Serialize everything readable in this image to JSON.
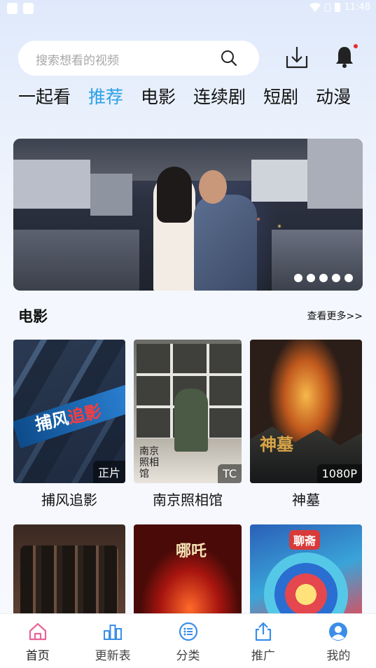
{
  "status_bar": {
    "time": "11:48"
  },
  "search": {
    "placeholder": "搜索想看的视频"
  },
  "tabs": [
    {
      "label": "一起看",
      "active": false
    },
    {
      "label": "推荐",
      "active": true
    },
    {
      "label": "电影",
      "active": false
    },
    {
      "label": "连续剧",
      "active": false
    },
    {
      "label": "短剧",
      "active": false
    },
    {
      "label": "动漫",
      "active": false
    }
  ],
  "banner": {
    "dot_count": 5
  },
  "section": {
    "title": "电影",
    "more_label": "查看更多>>"
  },
  "movies": [
    {
      "title": "捕风追影",
      "badge": "正片",
      "poster_text": "捕风追影"
    },
    {
      "title": "南京照相馆",
      "badge": "TC",
      "poster_text": "南京照相馆"
    },
    {
      "title": "神墓",
      "badge": "1080P",
      "poster_text": "神墓"
    },
    {
      "title": "",
      "badge": ""
    },
    {
      "title": "",
      "badge": "",
      "poster_text": "哪吒"
    },
    {
      "title": "",
      "badge": "",
      "poster_text": "聊斋"
    }
  ],
  "nav": [
    {
      "label": "首页",
      "icon": "home-icon",
      "active": true
    },
    {
      "label": "更新表",
      "icon": "schedule-icon",
      "active": false
    },
    {
      "label": "分类",
      "icon": "category-icon",
      "active": false
    },
    {
      "label": "推广",
      "icon": "share-icon",
      "active": false
    },
    {
      "label": "我的",
      "icon": "profile-icon",
      "active": false
    }
  ],
  "colors": {
    "accent": "#2aa0e8",
    "home_active": "#e8649a",
    "nav_icon": "#3a8ee8"
  }
}
